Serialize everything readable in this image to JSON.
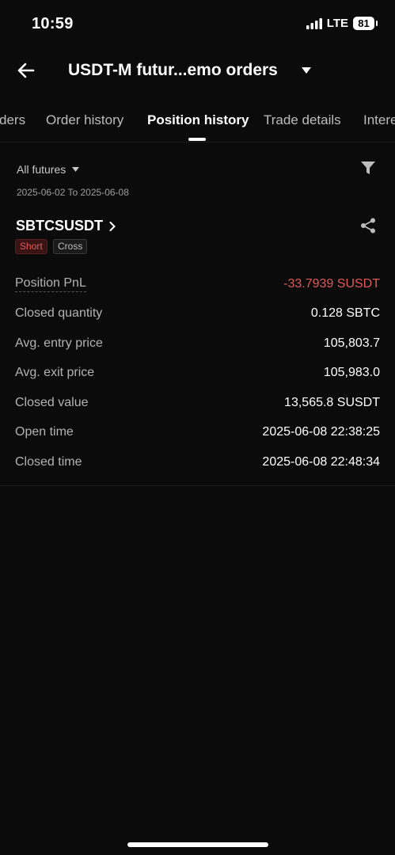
{
  "status_bar": {
    "time": "10:59",
    "network": "LTE",
    "battery": "81"
  },
  "header": {
    "title": "USDT-M futur...emo orders"
  },
  "tabs": [
    {
      "label": "ders"
    },
    {
      "label": "Order history"
    },
    {
      "label": "Position history"
    },
    {
      "label": "Trade details"
    },
    {
      "label": "Intere"
    }
  ],
  "filter": {
    "scope": "All futures",
    "date_range": "2025-06-02 To 2025-06-08"
  },
  "position": {
    "symbol": "SBTCSUSDT",
    "side": "Short",
    "margin_mode": "Cross",
    "rows": [
      {
        "label": "Position PnL",
        "value": "-33.7939 SUSDT"
      },
      {
        "label": "Closed quantity",
        "value": "0.128 SBTC"
      },
      {
        "label": "Avg. entry price",
        "value": "105,803.7"
      },
      {
        "label": "Avg. exit price",
        "value": "105,983.0"
      },
      {
        "label": "Closed value",
        "value": "13,565.8 SUSDT"
      },
      {
        "label": "Open time",
        "value": "2025-06-08 22:38:25"
      },
      {
        "label": "Closed time",
        "value": "2025-06-08 22:48:34"
      }
    ]
  },
  "colors": {
    "negative": "#e05a5a",
    "background": "#0b0b0b",
    "text": "#ffffff"
  }
}
